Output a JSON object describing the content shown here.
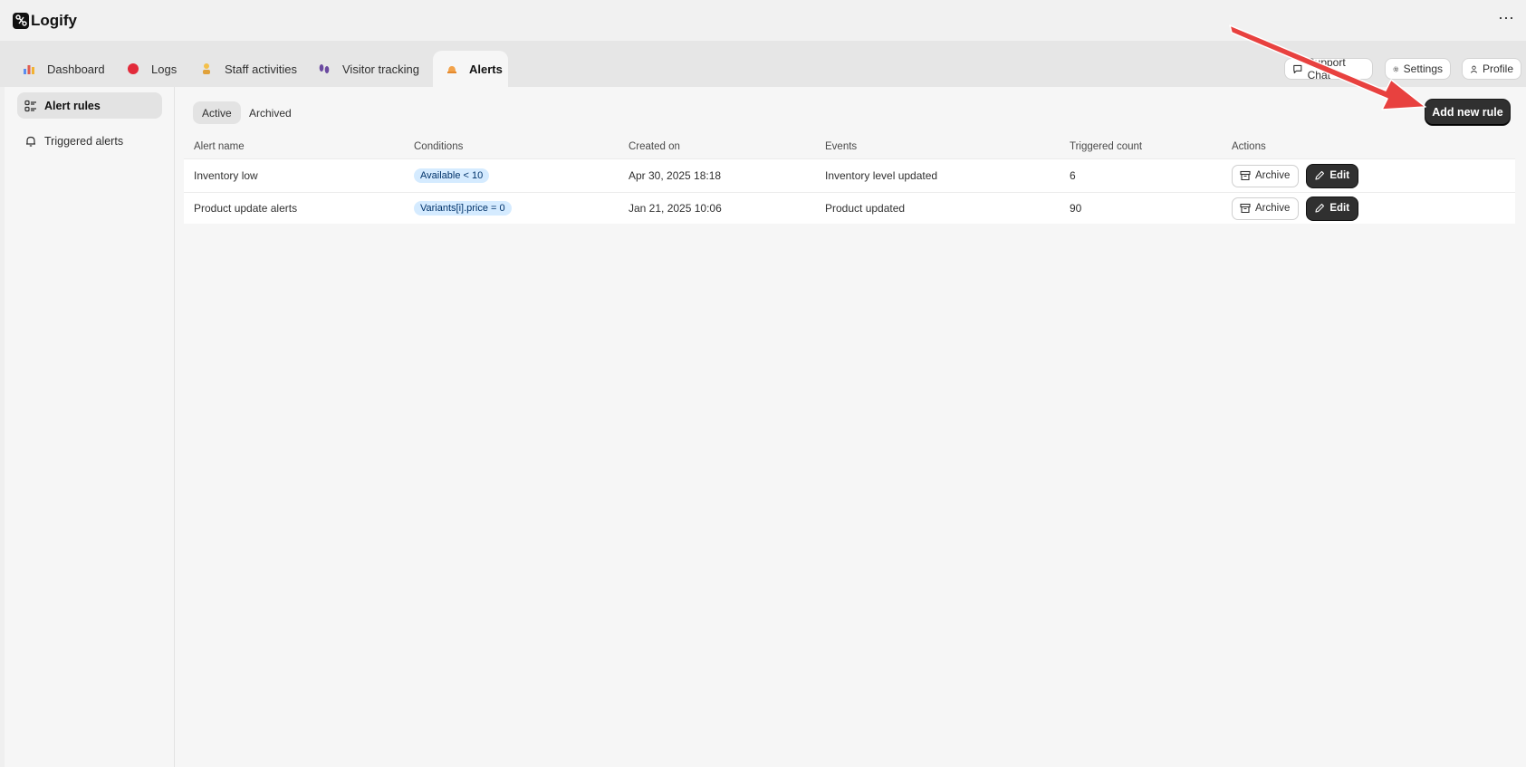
{
  "app": {
    "title": "Logify"
  },
  "nav": {
    "tabs": [
      {
        "label": "Dashboard",
        "icon": "bar-chart-icon"
      },
      {
        "label": "Logs",
        "icon": "red-circle-icon"
      },
      {
        "label": "Staff activities",
        "icon": "person-icon"
      },
      {
        "label": "Visitor tracking",
        "icon": "footprints-icon"
      },
      {
        "label": "Alerts",
        "icon": "bell-icon"
      }
    ],
    "active_tab": "Alerts",
    "actions": {
      "support_chat": "Support Chat",
      "settings": "Settings",
      "profile": "Profile"
    }
  },
  "sidebar": {
    "items": [
      {
        "label": "Alert rules",
        "icon": "list-icon"
      },
      {
        "label": "Triggered alerts",
        "icon": "bell-outline-icon"
      }
    ]
  },
  "main": {
    "segments": [
      "Active",
      "Archived"
    ],
    "add_button": "Add new rule",
    "columns": [
      "Alert name",
      "Conditions",
      "Created on",
      "Events",
      "Triggered count",
      "Actions"
    ],
    "rows": [
      {
        "name": "Inventory low",
        "condition": "Available < 10",
        "created": "Apr 30, 2025 18:18",
        "event": "Inventory level updated",
        "count": "6"
      },
      {
        "name": "Product update alerts",
        "condition": "Variants[i].price = 0",
        "created": "Jan 21, 2025 10:06",
        "event": "Product updated",
        "count": "90"
      }
    ],
    "row_actions": {
      "archive": "Archive",
      "edit": "Edit"
    }
  },
  "colors": {
    "primary_button": "#303030",
    "pill_bg": "#d5ebff",
    "annotation_arrow": "#e8413f"
  }
}
